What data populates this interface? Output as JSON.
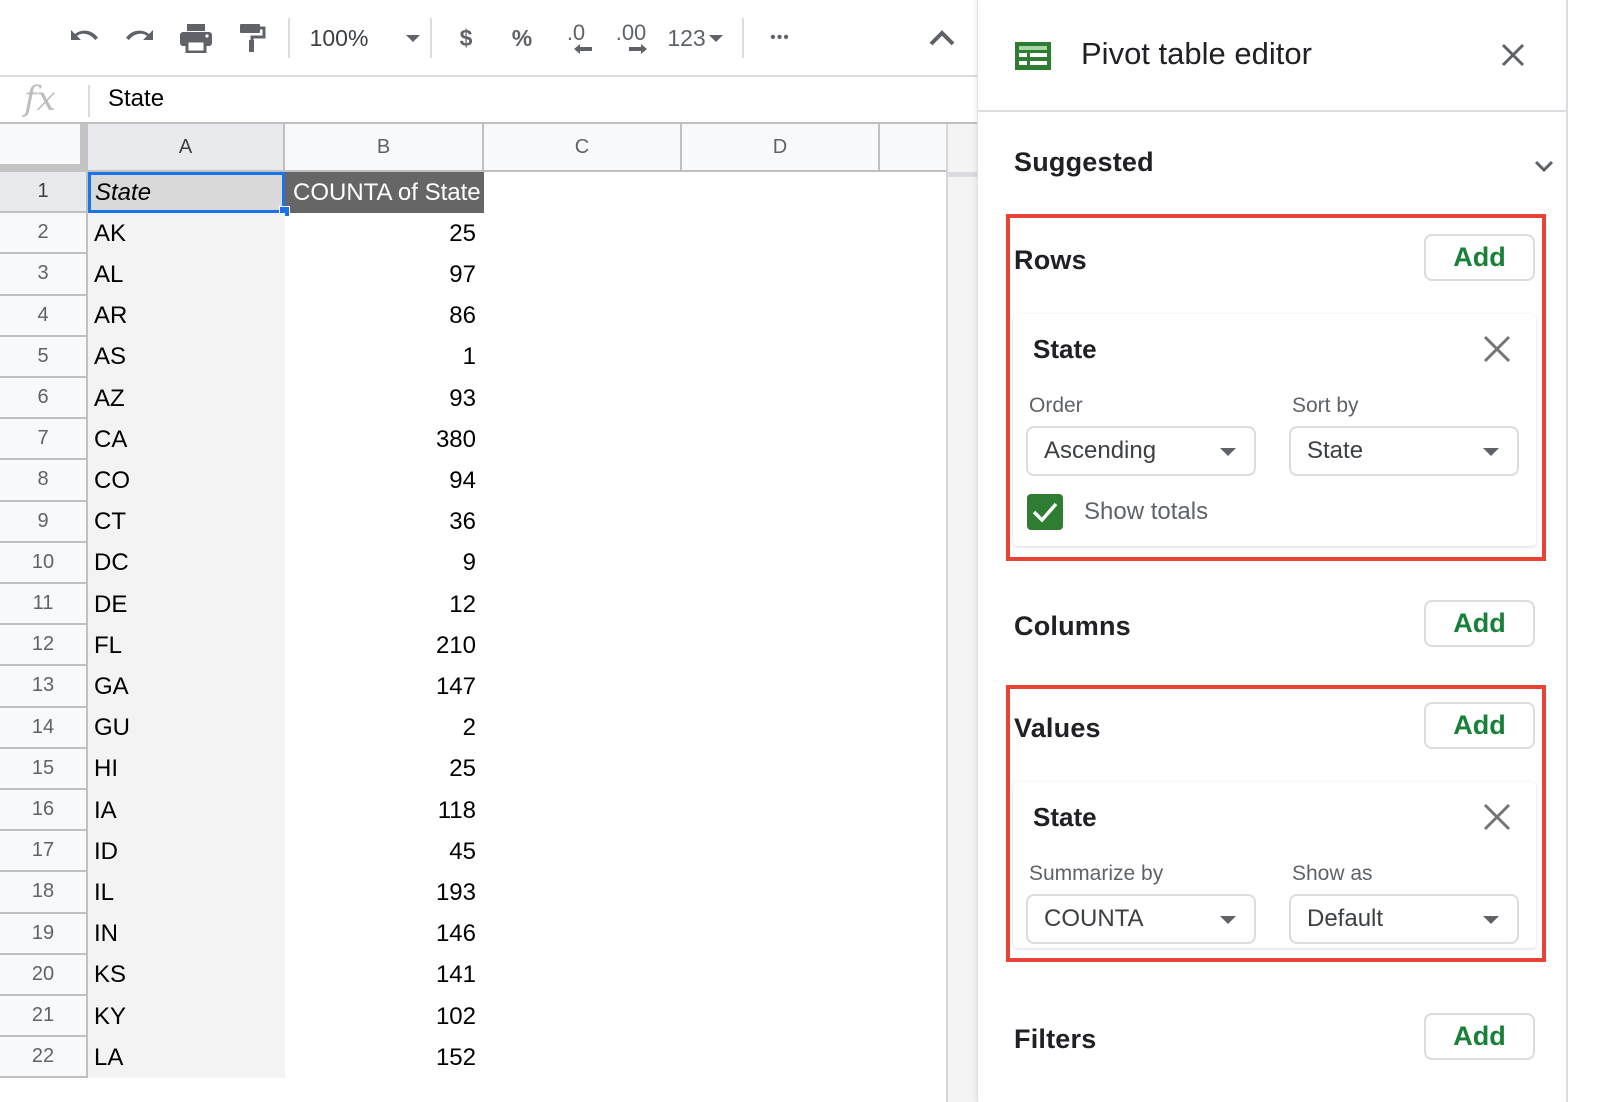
{
  "toolbar": {
    "undo_icon": "undo-icon",
    "redo_icon": "redo-icon",
    "print_icon": "print-icon",
    "paint_format_icon": "paint-format-icon",
    "zoom_value": "100%",
    "currency_label": "$",
    "percent_label": "%",
    "decrease_decimal_label": ".0",
    "increase_decimal_label": ".00",
    "number_format_label": "123",
    "more_label": "•••",
    "collapse_icon": "chevron-up-icon"
  },
  "formula_bar": {
    "fx_label": "fx",
    "value": "State"
  },
  "sheet": {
    "columns": [
      "A",
      "B",
      "C",
      "D"
    ],
    "header_row": {
      "row_number": "1",
      "a": "State",
      "b": "COUNTA of State"
    },
    "rows": [
      {
        "n": "2",
        "state": "AK",
        "count": "25"
      },
      {
        "n": "3",
        "state": "AL",
        "count": "97"
      },
      {
        "n": "4",
        "state": "AR",
        "count": "86"
      },
      {
        "n": "5",
        "state": "AS",
        "count": "1"
      },
      {
        "n": "6",
        "state": "AZ",
        "count": "93"
      },
      {
        "n": "7",
        "state": "CA",
        "count": "380"
      },
      {
        "n": "8",
        "state": "CO",
        "count": "94"
      },
      {
        "n": "9",
        "state": "CT",
        "count": "36"
      },
      {
        "n": "10",
        "state": "DC",
        "count": "9"
      },
      {
        "n": "11",
        "state": "DE",
        "count": "12"
      },
      {
        "n": "12",
        "state": "FL",
        "count": "210"
      },
      {
        "n": "13",
        "state": "GA",
        "count": "147"
      },
      {
        "n": "14",
        "state": "GU",
        "count": "2"
      },
      {
        "n": "15",
        "state": "HI",
        "count": "25"
      },
      {
        "n": "16",
        "state": "IA",
        "count": "118"
      },
      {
        "n": "17",
        "state": "ID",
        "count": "45"
      },
      {
        "n": "18",
        "state": "IL",
        "count": "193"
      },
      {
        "n": "19",
        "state": "IN",
        "count": "146"
      },
      {
        "n": "20",
        "state": "KS",
        "count": "141"
      },
      {
        "n": "21",
        "state": "KY",
        "count": "102"
      },
      {
        "n": "22",
        "state": "LA",
        "count": "152"
      }
    ]
  },
  "editor": {
    "title": "Pivot table editor",
    "icon": "sheets-table-icon",
    "suggested_label": "Suggested",
    "rows": {
      "label": "Rows",
      "add_label": "Add",
      "field": {
        "name": "State",
        "order_label": "Order",
        "order_value": "Ascending",
        "sort_by_label": "Sort by",
        "sort_by_value": "State",
        "show_totals_label": "Show totals",
        "show_totals_checked": true
      }
    },
    "columns": {
      "label": "Columns",
      "add_label": "Add"
    },
    "values": {
      "label": "Values",
      "add_label": "Add",
      "field": {
        "name": "State",
        "summarize_label": "Summarize by",
        "summarize_value": "COUNTA",
        "show_as_label": "Show as",
        "show_as_value": "Default"
      }
    },
    "filters": {
      "label": "Filters",
      "add_label": "Add"
    }
  },
  "colors": {
    "accent_green": "#188038",
    "sheets_green": "#2e7d32",
    "highlight_red": "#ea4335",
    "selection_blue": "#1a73e8",
    "pivot_header_gray": "#666666"
  }
}
